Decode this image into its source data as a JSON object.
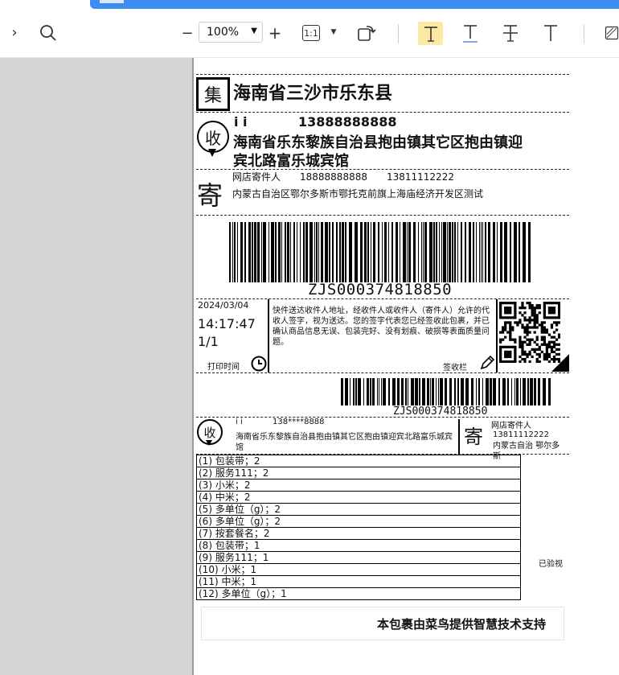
{
  "toolbar": {
    "zoom_value": "100%",
    "zoom_in": "+",
    "zoom_out": "−",
    "actual_size_label": "1:1"
  },
  "label": {
    "dist_icon_char": "集",
    "dest_region": "海南省三沙市乐东县",
    "recv_icon_char": "收",
    "receiver_name": "i i",
    "receiver_phone": "13888888888",
    "receiver_addr_1": "海南省乐东黎族自治县抱由镇其它区抱由镇迎",
    "receiver_addr_2": "宾北路富乐城宾馆",
    "send_icon_char": "寄",
    "sender_line": "网店寄件人　　18888888888　　13811112222",
    "sender_addr": "内蒙古自治区鄂尔多斯市鄂托克前旗上海庙经济开发区测试",
    "tracking_no": "ZJS000374818850",
    "print_date": "2024/03/04",
    "print_time": "14:17:47",
    "page_count": "1/1",
    "print_time_label": "打印时间",
    "notice": "快件送达收件人地址，经收件人或收件人（寄件人）允许的代收人签字，视为送达。您的签字代表您已经签收此包裹，并已确认商品信息无误、包装完好、没有划痕、破损等表面质量问题。",
    "sign_label": "签收栏",
    "tracking_no_small": "ZJS000374818850",
    "stub_receiver_name": "i i",
    "stub_receiver_phone": "138****8888",
    "stub_receiver_addr": "海南省乐东黎族自治县抱由镇其它区抱由镇迎宾北路富乐城宾馆",
    "stub_sender_name": "网店寄件人",
    "stub_sender_phone": "13811112222",
    "stub_sender_addr": "内蒙古自治 鄂尔多斯",
    "items": [
      "(1) 包装带；2",
      "(2) 服务111；2",
      "(3) 小米；2",
      "(4) 中米；2",
      "(5) 多单位（g）；2",
      "(6) 多单位（g）；2",
      "(7) 按套餐名；2",
      "(8) 包装带；1",
      "(9) 服务111；1",
      "(10) 小米；1",
      "(11) 中米；1",
      "(12) 多单位（g）；1"
    ],
    "inspected": "已验视",
    "footer": "本包裹由菜鸟提供智慧技术支持"
  }
}
